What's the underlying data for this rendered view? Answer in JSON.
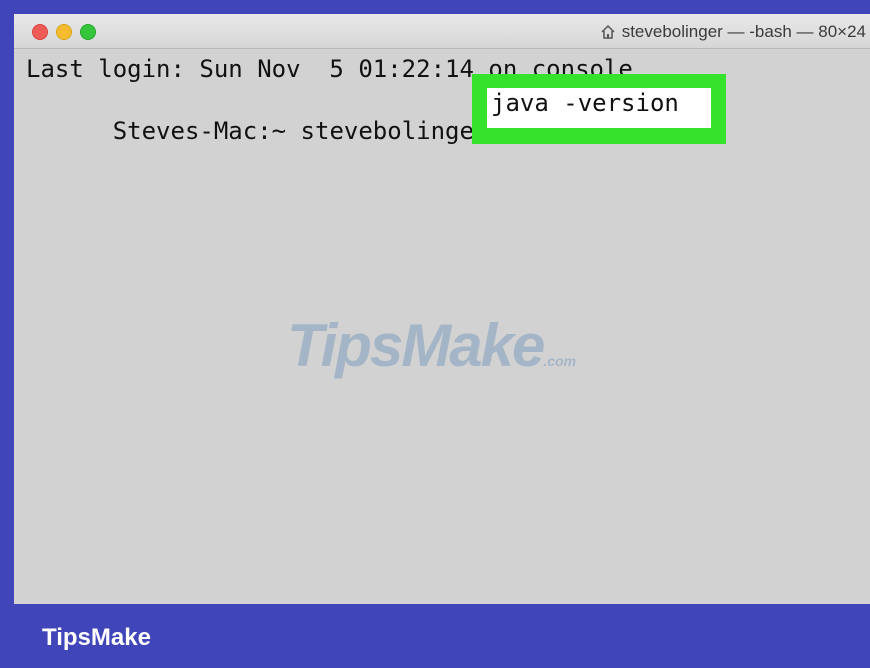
{
  "window": {
    "title": "stevebolinger — -bash — 80×24",
    "title_icon": "home-icon"
  },
  "terminal": {
    "line1": "Last login: Sun Nov  5 01:22:14 on console",
    "prompt": "Steves-Mac:~ stevebolinger$ ",
    "command": "java -version"
  },
  "watermark": {
    "main": "TipsMake",
    "suffix": ".com"
  },
  "footer": {
    "brand": "TipsMake"
  },
  "colors": {
    "frame": "#4046b9",
    "highlight": "#37e22d",
    "terminal_bg": "#d2d2d2"
  }
}
